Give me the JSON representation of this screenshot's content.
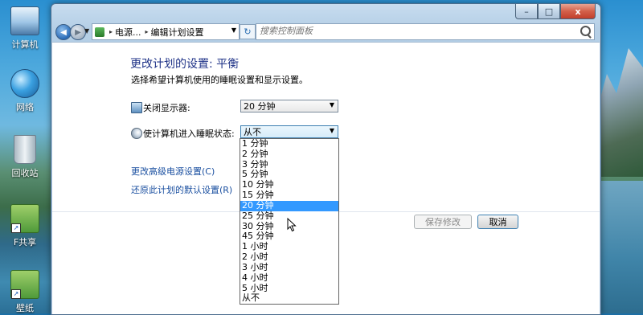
{
  "desktop": {
    "icons": [
      {
        "label": "计算机",
        "icon": "computer-icon"
      },
      {
        "label": "网络",
        "icon": "network-icon"
      },
      {
        "label": "回收站",
        "icon": "recycle-bin-icon"
      },
      {
        "label": "F共享",
        "icon": "folder-shortcut-icon"
      },
      {
        "label": "壁纸",
        "icon": "folder-shortcut-icon"
      }
    ]
  },
  "window": {
    "caption": {
      "minimize": "–",
      "maximize": "□",
      "close": "x"
    },
    "address": {
      "segments": [
        "电源...",
        "编辑计划设置"
      ],
      "search_placeholder": "搜索控制面板"
    },
    "content": {
      "title": "更改计划的设置: 平衡",
      "description": "选择希望计算机使用的睡眠设置和显示设置。",
      "display_off": {
        "label": "关闭显示器:",
        "value": "20 分钟"
      },
      "sleep": {
        "label": "使计算机进入睡眠状态:",
        "value": "从不",
        "options": [
          "1 分钟",
          "2 分钟",
          "3 分钟",
          "5 分钟",
          "10 分钟",
          "15 分钟",
          "20 分钟",
          "25 分钟",
          "30 分钟",
          "45 分钟",
          "1 小时",
          "2 小时",
          "3 小时",
          "4 小时",
          "5 小时",
          "从不"
        ],
        "highlighted": "20 分钟"
      },
      "links": {
        "advanced": "更改高级电源设置(C)",
        "restore": "还原此计划的默认设置(R)"
      },
      "buttons": {
        "save": "保存修改",
        "cancel": "取消"
      }
    }
  }
}
